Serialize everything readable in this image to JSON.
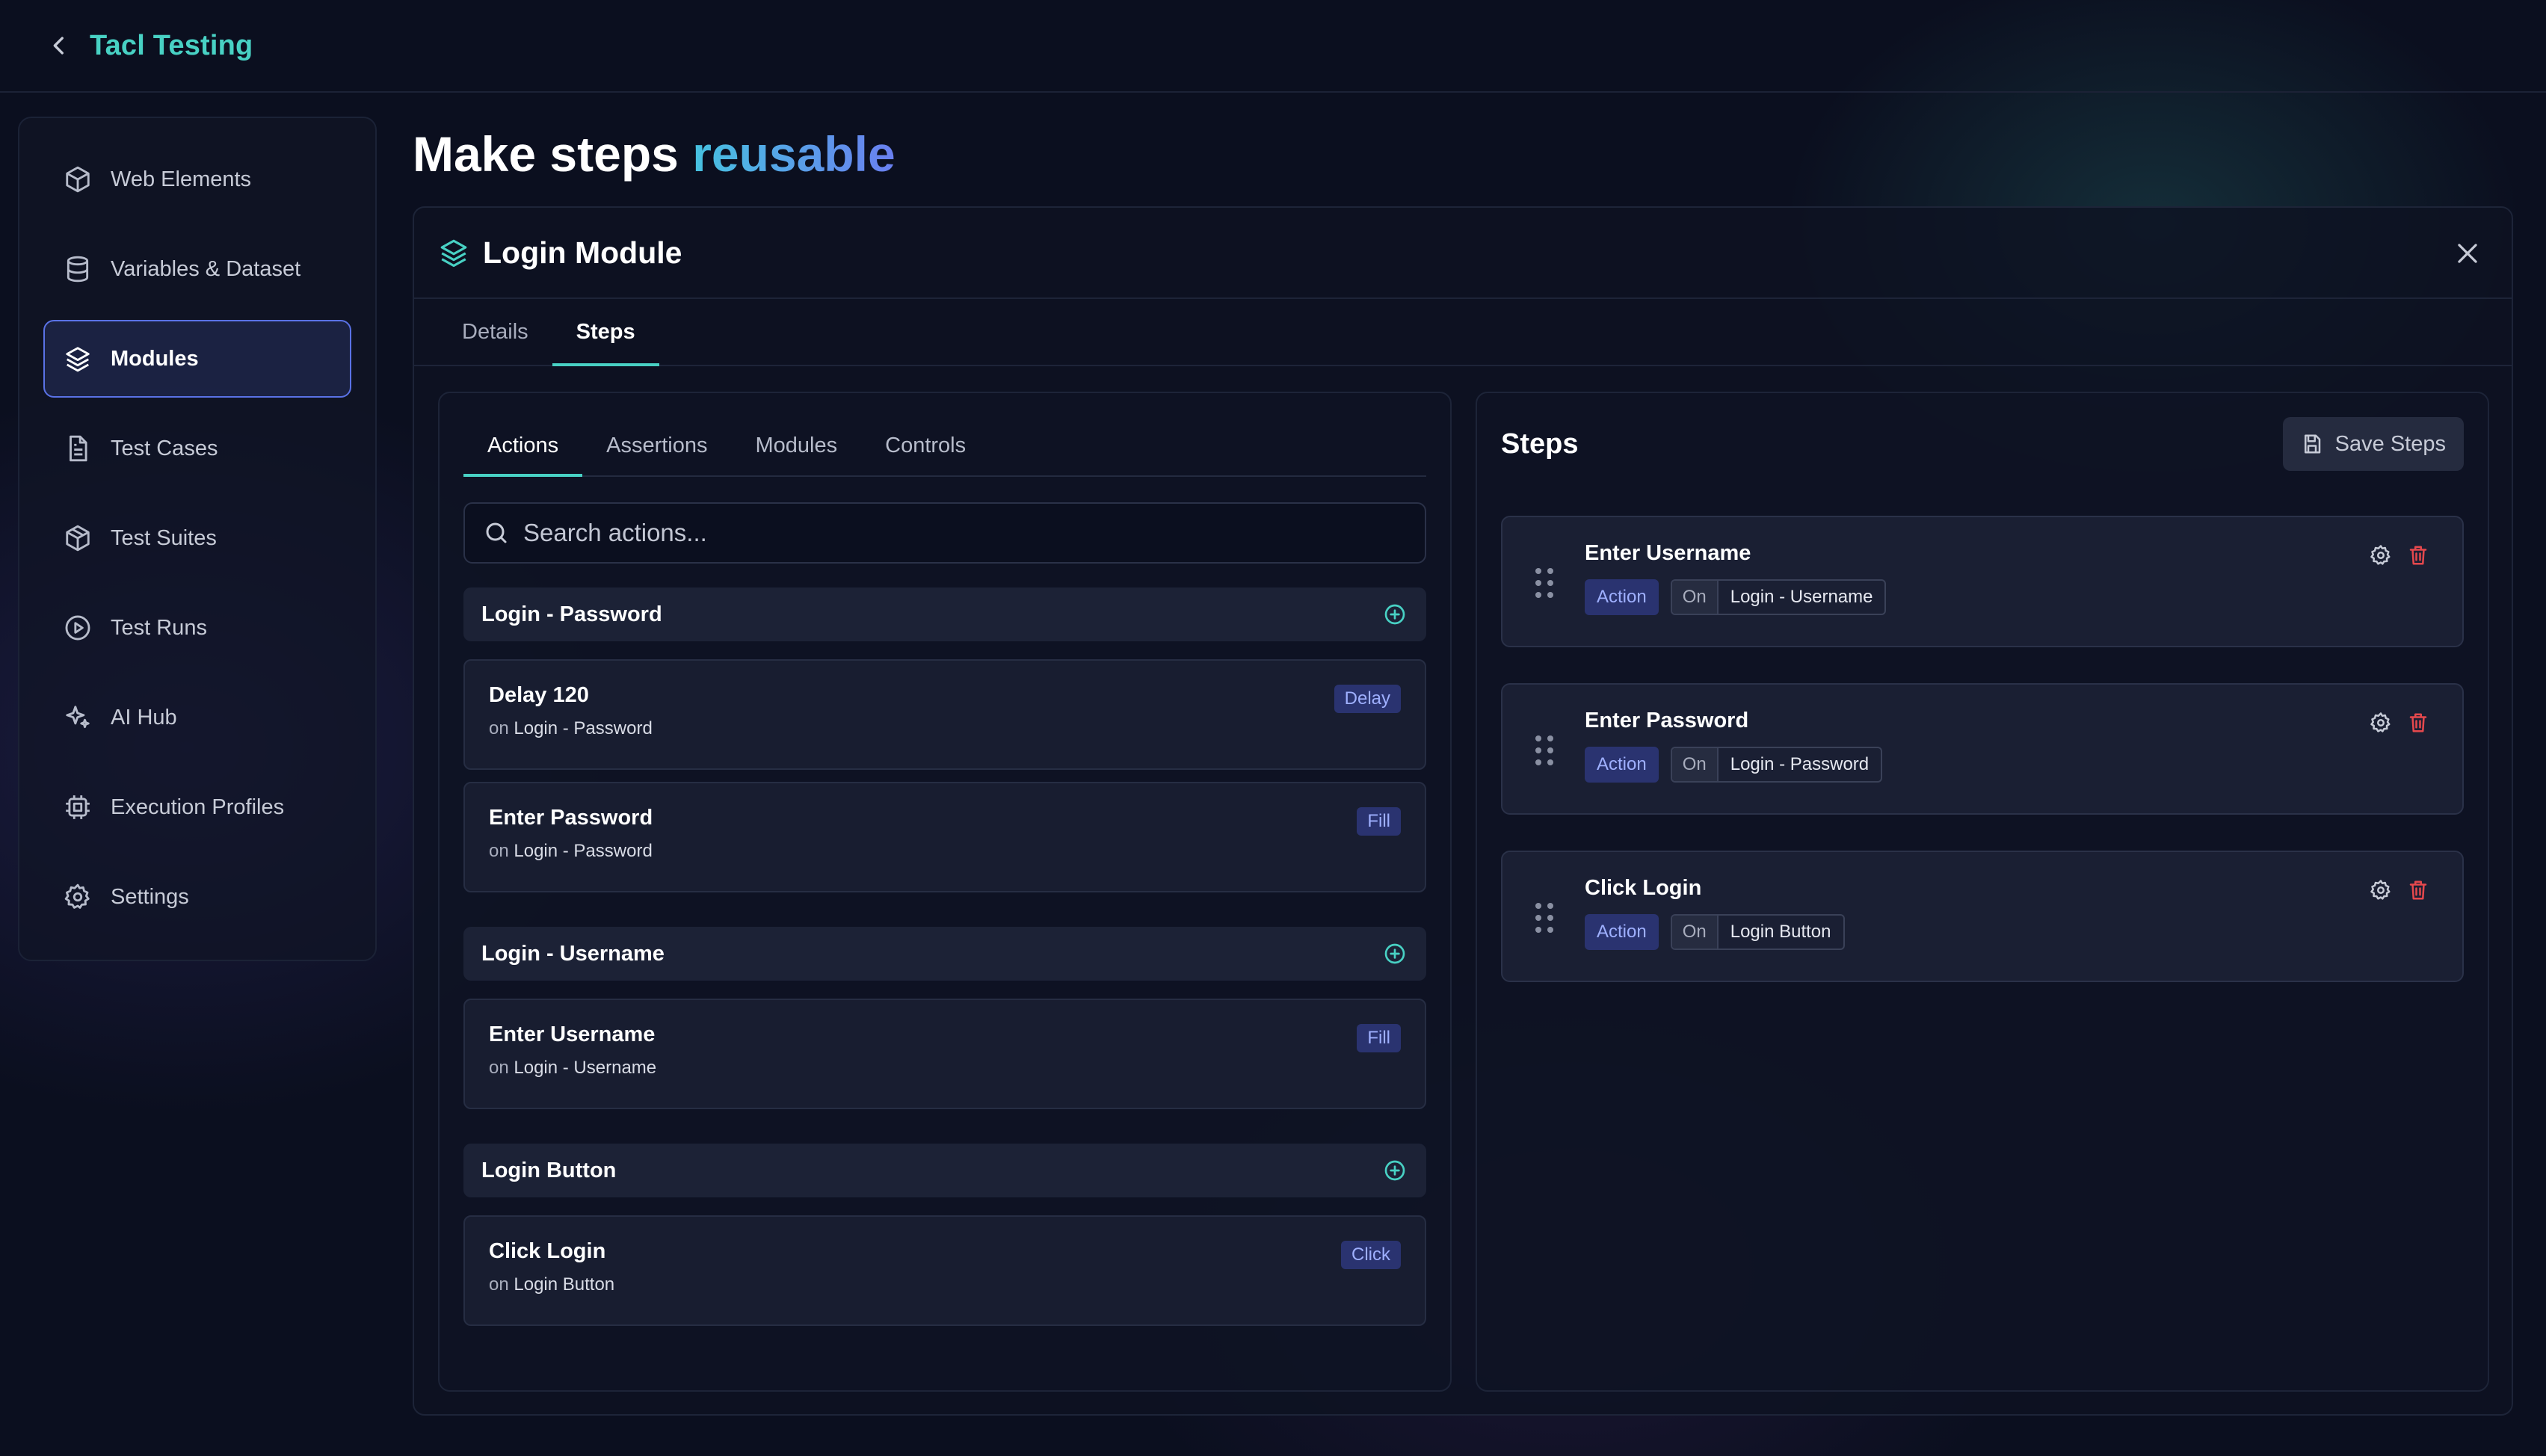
{
  "app": {
    "back_icon": "chevron-left-icon",
    "title": "Tacl Testing"
  },
  "sidebar": {
    "items": [
      {
        "label": "Web Elements",
        "icon": "cube-icon",
        "active": false
      },
      {
        "label": "Variables & Dataset",
        "icon": "database-icon",
        "active": false
      },
      {
        "label": "Modules",
        "icon": "layers-icon",
        "active": true
      },
      {
        "label": "Test Cases",
        "icon": "file-text-icon",
        "active": false
      },
      {
        "label": "Test Suites",
        "icon": "package-icon",
        "active": false
      },
      {
        "label": "Test Runs",
        "icon": "play-circle-icon",
        "active": false
      },
      {
        "label": "AI Hub",
        "icon": "sparkles-icon",
        "active": false
      },
      {
        "label": "Execution Profiles",
        "icon": "cpu-icon",
        "active": false
      },
      {
        "label": "Settings",
        "icon": "gear-icon",
        "active": false
      }
    ]
  },
  "page": {
    "heading_main": "Make steps ",
    "heading_accent": "reusable"
  },
  "modal": {
    "title": "Login Module",
    "tabs": [
      {
        "label": "Details",
        "active": false
      },
      {
        "label": "Steps",
        "active": true
      }
    ],
    "actions_panel": {
      "tabs": [
        {
          "label": "Actions",
          "active": true
        },
        {
          "label": "Assertions",
          "active": false
        },
        {
          "label": "Modules",
          "active": false
        },
        {
          "label": "Controls",
          "active": false
        }
      ],
      "search": {
        "placeholder": "Search actions...",
        "value": ""
      },
      "groups": [
        {
          "title": "Login - Password",
          "actions": [
            {
              "name": "Delay 120",
              "on_prefix": "on",
              "target": "Login - Password",
              "type": "Delay"
            },
            {
              "name": "Enter Password",
              "on_prefix": "on",
              "target": "Login - Password",
              "type": "Fill"
            }
          ]
        },
        {
          "title": "Login - Username",
          "actions": [
            {
              "name": "Enter Username",
              "on_prefix": "on",
              "target": "Login - Username",
              "type": "Fill"
            }
          ]
        },
        {
          "title": "Login Button",
          "actions": [
            {
              "name": "Click Login",
              "on_prefix": "on",
              "target": "Login Button",
              "type": "Click"
            }
          ]
        }
      ]
    },
    "steps_panel": {
      "title": "Steps",
      "save_label": "Save Steps",
      "steps": [
        {
          "name": "Enter Username",
          "kind": "Action",
          "on_label": "On",
          "target": "Login - Username"
        },
        {
          "name": "Enter Password",
          "kind": "Action",
          "on_label": "On",
          "target": "Login - Password"
        },
        {
          "name": "Click Login",
          "kind": "Action",
          "on_label": "On",
          "target": "Login Button"
        }
      ]
    }
  },
  "colors": {
    "background": "#0b0f1f",
    "brand": "#48d1c4",
    "accent_blue": "#6a7ff0",
    "badge_bg": "#2a3370",
    "badge_text": "#9fb0ff",
    "delete": "#e5484d"
  }
}
